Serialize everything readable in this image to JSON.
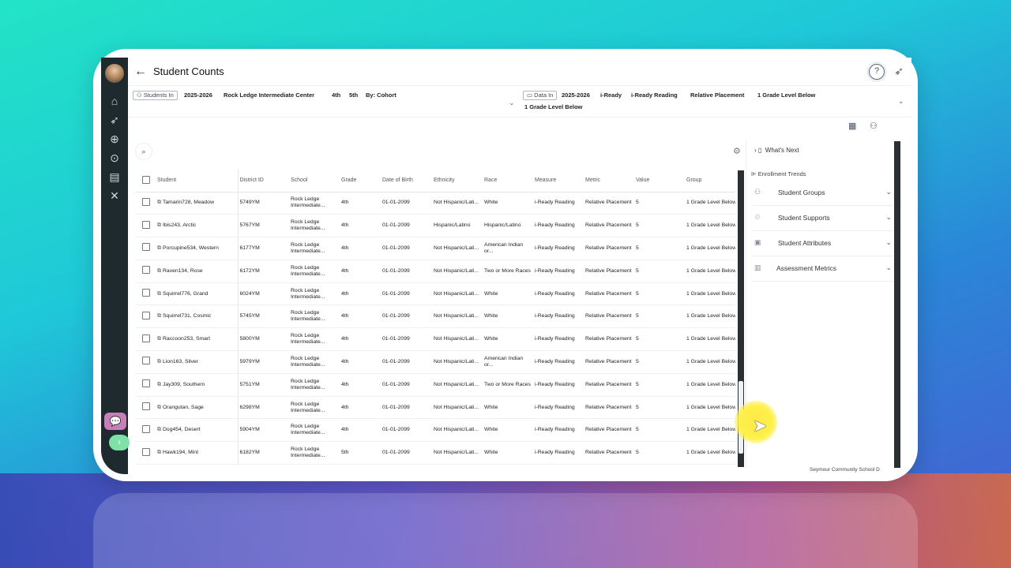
{
  "header": {
    "title": "Student Counts",
    "help": "?"
  },
  "filters": {
    "students_in_label": "Students In",
    "students_in": [
      "2025-2026",
      "Rock Ledge Intermediate Center",
      "4th",
      "5th",
      "By: Cohort"
    ],
    "data_in_label": "Data In",
    "data_in": [
      "2025-2026",
      "i-Ready",
      "i-Ready Reading",
      "Relative Placement",
      "1 Grade Level Below",
      "1 Grade Level Below"
    ]
  },
  "table": {
    "columns": [
      "Student",
      "District ID",
      "School",
      "Grade",
      "Date of Birth",
      "Ethnicity",
      "Race",
      "Measure",
      "Metric",
      "Value",
      "Group"
    ],
    "rows": [
      {
        "student": "Tamarin728, Meadow",
        "id": "5749YM",
        "school": "Rock Ledge Intermediate...",
        "grade": "4th",
        "dob": "01-01-2099",
        "ethnicity": "Not Hispanic/Lati...",
        "race": "White",
        "measure": "i-Ready Reading",
        "metric": "Relative Placement",
        "value": "5",
        "group": "1 Grade Level Below"
      },
      {
        "student": "Ibis243, Arctic",
        "id": "5767YM",
        "school": "Rock Ledge Intermediate...",
        "grade": "4th",
        "dob": "01-01-2099",
        "ethnicity": "Hispanic/Latino",
        "race": "Hispanic/Latino",
        "measure": "i-Ready Reading",
        "metric": "Relative Placement",
        "value": "5",
        "group": "1 Grade Level Below"
      },
      {
        "student": "Porcupine534, Western",
        "id": "6177YM",
        "school": "Rock Ledge Intermediate...",
        "grade": "4th",
        "dob": "01-01-2099",
        "ethnicity": "Not Hispanic/Lati...",
        "race": "American Indian or...",
        "measure": "i-Ready Reading",
        "metric": "Relative Placement",
        "value": "5",
        "group": "1 Grade Level Below"
      },
      {
        "student": "Raven134, Rose",
        "id": "6172YM",
        "school": "Rock Ledge Intermediate...",
        "grade": "4th",
        "dob": "01-01-2099",
        "ethnicity": "Not Hispanic/Lati...",
        "race": "Two or More Races",
        "measure": "i-Ready Reading",
        "metric": "Relative Placement",
        "value": "5",
        "group": "1 Grade Level Below"
      },
      {
        "student": "Squirrel776, Grand",
        "id": "6024YM",
        "school": "Rock Ledge Intermediate...",
        "grade": "4th",
        "dob": "01-01-2099",
        "ethnicity": "Not Hispanic/Lati...",
        "race": "White",
        "measure": "i-Ready Reading",
        "metric": "Relative Placement",
        "value": "5",
        "group": "1 Grade Level Below"
      },
      {
        "student": "Squirrel731, Cosmic",
        "id": "5745YM",
        "school": "Rock Ledge Intermediate...",
        "grade": "4th",
        "dob": "01-01-2099",
        "ethnicity": "Not Hispanic/Lati...",
        "race": "White",
        "measure": "i-Ready Reading",
        "metric": "Relative Placement",
        "value": "5",
        "group": "1 Grade Level Below"
      },
      {
        "student": "Raccoon253, Smart",
        "id": "5800YM",
        "school": "Rock Ledge Intermediate...",
        "grade": "4th",
        "dob": "01-01-2099",
        "ethnicity": "Not Hispanic/Lati...",
        "race": "White",
        "measure": "i-Ready Reading",
        "metric": "Relative Placement",
        "value": "5",
        "group": "1 Grade Level Below"
      },
      {
        "student": "Lion163, Silver",
        "id": "5979YM",
        "school": "Rock Ledge Intermediate...",
        "grade": "4th",
        "dob": "01-01-2099",
        "ethnicity": "Not Hispanic/Lati...",
        "race": "American Indian or...",
        "measure": "i-Ready Reading",
        "metric": "Relative Placement",
        "value": "5",
        "group": "1 Grade Level Below"
      },
      {
        "student": "Jay309, Southern",
        "id": "5751YM",
        "school": "Rock Ledge Intermediate...",
        "grade": "4th",
        "dob": "01-01-2099",
        "ethnicity": "Not Hispanic/Lati...",
        "race": "Two or More Races",
        "measure": "i-Ready Reading",
        "metric": "Relative Placement",
        "value": "5",
        "group": "1 Grade Level Below"
      },
      {
        "student": "Orangutan, Sage",
        "id": "6298YM",
        "school": "Rock Ledge Intermediate...",
        "grade": "4th",
        "dob": "01-01-2099",
        "ethnicity": "Not Hispanic/Lati...",
        "race": "White",
        "measure": "i-Ready Reading",
        "metric": "Relative Placement",
        "value": "5",
        "group": "1 Grade Level Below"
      },
      {
        "student": "Dog454, Desert",
        "id": "5904YM",
        "school": "Rock Ledge Intermediate...",
        "grade": "4th",
        "dob": "01-01-2099",
        "ethnicity": "Not Hispanic/Lati...",
        "race": "White",
        "measure": "i-Ready Reading",
        "metric": "Relative Placement",
        "value": "5",
        "group": "1 Grade Level Below"
      },
      {
        "student": "Hawk194, Mint",
        "id": "6182YM",
        "school": "Rock Ledge Intermediate...",
        "grade": "5th",
        "dob": "01-01-2099",
        "ethnicity": "Not Hispanic/Lati...",
        "race": "White",
        "measure": "i-Ready Reading",
        "metric": "Relative Placement",
        "value": "5",
        "group": "1 Grade Level Below"
      }
    ]
  },
  "panel": {
    "whats_next": "What's Next",
    "enrollment_trends": "Enrollment Trends",
    "sections": [
      "Student Groups",
      "Student Supports",
      "Student Attributes",
      "Assessment Metrics"
    ]
  },
  "footer": "Seymour Community School D"
}
